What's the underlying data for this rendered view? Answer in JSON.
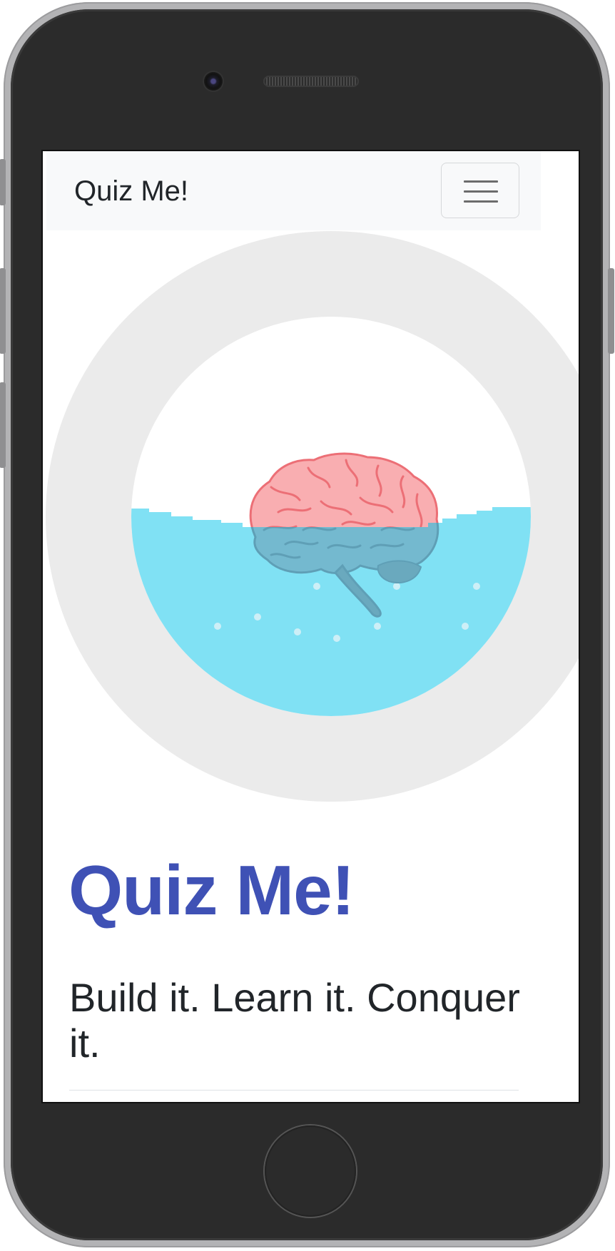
{
  "navbar": {
    "brand": "Quiz Me!",
    "toggler_icon": "hamburger-menu-icon"
  },
  "hero": {
    "illustration": "brain-in-water-icon",
    "title": "Quiz Me!",
    "subtitle": "Build it. Learn it. Conquer it."
  },
  "colors": {
    "title": "#3f51b5",
    "ring": "#ebebeb",
    "water": "#80e1f4",
    "brain": "#f9aeb1",
    "brain_detail": "#ec6f76",
    "brain_submerged": "#74b9cf"
  }
}
